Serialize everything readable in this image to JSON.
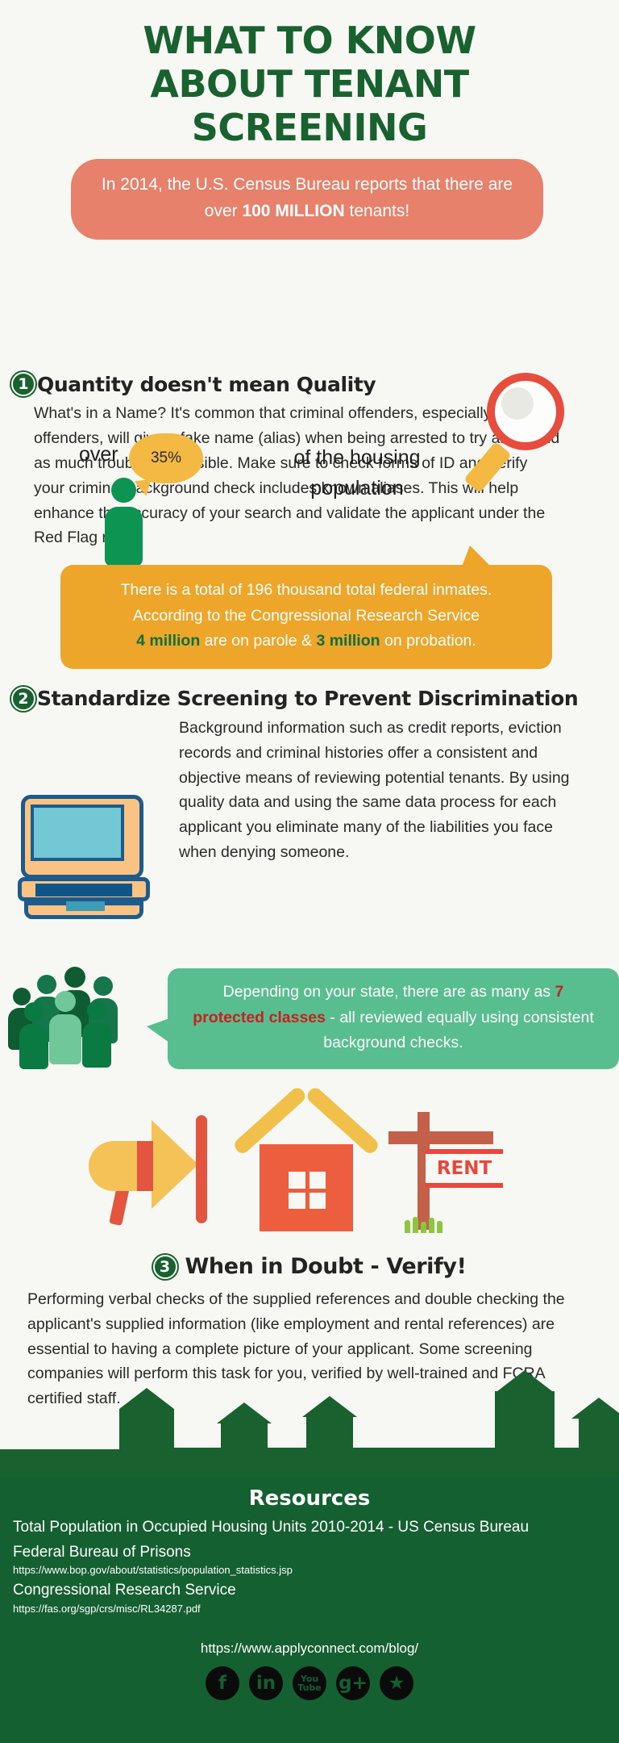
{
  "title": {
    "line1": "WHAT TO KNOW",
    "line2": "ABOUT TENANT",
    "line3": "SCREENING"
  },
  "intro": {
    "bubble_pre": "In 2014, the U.S. Census Bureau reports that there are over ",
    "bubble_bold": "100 MILLION",
    "bubble_post": " tenants!",
    "over_label": "over",
    "percent": "35%",
    "housing_label": "of the housing population"
  },
  "sections": [
    {
      "number": "1",
      "title": "Quantity doesn't mean Quality",
      "body": "What's in a Name? It's common that criminal offenders, especially repeat offenders, will give a fake name (alias) when being arrested to try and avoid as much trouble as possible. Make sure to check forms of ID and verify your criminal background check includes known aliases. This will help enhance the accuracy of your search and validate the applicant under the Red Flag rule."
    },
    {
      "number": "2",
      "title": "Standardize Screening to Prevent Discrimination",
      "body": "Background information such as credit reports, eviction records and criminal histories offer a consistent and objective means of reviewing potential tenants. By using quality data and using the same data process for each applicant you eliminate many of the liabilities you face when denying someone."
    },
    {
      "number": "3",
      "title": "When in Doubt - Verify!",
      "body": "Performing verbal checks of the supplied references and double checking the applicant's supplied information (like employment and rental references) are essential to having a complete picture of your applicant. Some screening companies will perform this task for you, verified by well-trained and FCRA certified staff."
    }
  ],
  "orange_callout": {
    "line1": "There is a total of 196 thousand total federal inmates.",
    "line2": "According to the Congressional Research Service",
    "line3_a": "4 million",
    "line3_b": " are on parole & ",
    "line3_c": "3 million",
    "line3_d": " on probation."
  },
  "green_callout": {
    "part1": "Depending on your state, there are as many as ",
    "highlight": "7 protected classes",
    "part2": " - all reviewed equally using consistent background checks."
  },
  "rent_sign": {
    "label": "RENT"
  },
  "footer": {
    "heading": "Resources",
    "entries": [
      {
        "name": "Total Population in Occupied Housing Units 2010-2014 - US Census Bureau",
        "url": ""
      },
      {
        "name": "Federal Bureau of Prisons",
        "url": "https://www.bop.gov/about/statistics/population_statistics.jsp"
      },
      {
        "name": "Congressional Research Service",
        "url": "https://fas.org/sgp/crs/misc/RL34287.pdf"
      }
    ],
    "blog_url": "https://www.applyconnect.com/blog/",
    "social": [
      {
        "name": "facebook-icon",
        "glyph": "f"
      },
      {
        "name": "linkedin-icon",
        "glyph": "in"
      },
      {
        "name": "youtube-icon",
        "glyph": "You Tube"
      },
      {
        "name": "googleplus-icon",
        "glyph": "g+"
      },
      {
        "name": "twitter-icon",
        "glyph": "★"
      }
    ]
  },
  "colors": {
    "green_dark": "#19622f",
    "red_bubble": "#e8816c",
    "yellow": "#f4b942",
    "orange": "#eda52a",
    "green_light": "#58bd8f",
    "accent_red": "#cc2020",
    "background": "#f7f7f3"
  }
}
